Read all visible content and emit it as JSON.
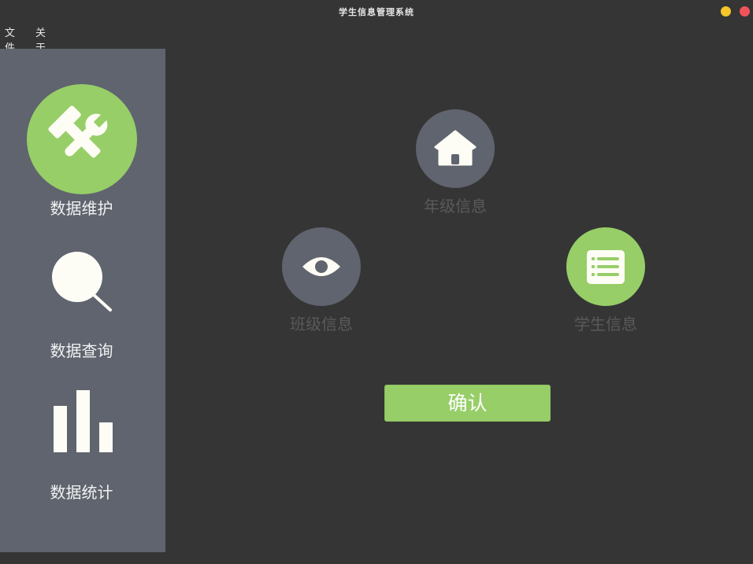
{
  "window": {
    "title": "学生信息管理系统",
    "buttons": [
      "minimize",
      "close"
    ]
  },
  "menu": {
    "file": "文件",
    "about": "关于"
  },
  "sidebar": {
    "items": [
      {
        "label": "数据维护",
        "icon": "tools-icon",
        "active": true
      },
      {
        "label": "数据查询",
        "icon": "search-icon",
        "active": false
      },
      {
        "label": "数据统计",
        "icon": "bar-chart-icon",
        "active": false
      }
    ]
  },
  "main": {
    "options": [
      {
        "label": "年级信息",
        "icon": "home-icon",
        "selected": false
      },
      {
        "label": "班级信息",
        "icon": "eye-icon",
        "selected": false
      },
      {
        "label": "学生信息",
        "icon": "list-icon",
        "selected": true
      }
    ],
    "confirm_label": "确认"
  },
  "colors": {
    "background": "#353535",
    "sidebar": "#5f646e",
    "accent_green": "#97ce68",
    "icon_white": "#fdfdf5",
    "dim_label": "#5a5a5a"
  }
}
